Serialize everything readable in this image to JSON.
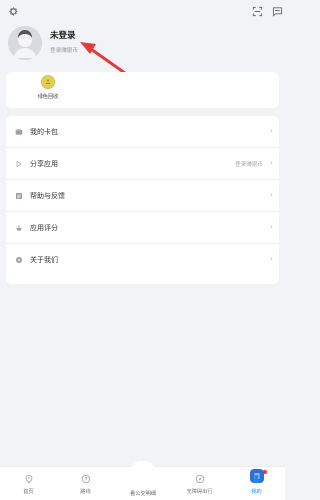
{
  "header": {
    "settings_icon": "gear-icon",
    "scan_icon": "scan-icon",
    "message_icon": "message-icon"
  },
  "profile": {
    "name": "未登录",
    "subtitle": "登录赚银币"
  },
  "quick_actions": [
    {
      "label": "绿色回收",
      "icon": "recycle-icon",
      "colors": {
        "fill": "#f2c94c",
        "ring": "#9bd56a"
      }
    }
  ],
  "menu": {
    "items": [
      {
        "label": "我的卡包",
        "icon": "wallet-icon",
        "hint": ""
      },
      {
        "label": "分享应用",
        "icon": "share-icon",
        "hint": "登录赚银币"
      },
      {
        "label": "帮助与反馈",
        "icon": "help-icon",
        "hint": ""
      },
      {
        "label": "应用评分",
        "icon": "rating-icon",
        "hint": ""
      },
      {
        "label": "关于我们",
        "icon": "about-icon",
        "hint": ""
      }
    ]
  },
  "tabbar": {
    "tabs": [
      {
        "label": "首页",
        "icon": "home-icon"
      },
      {
        "label": "路线",
        "icon": "route-icon"
      },
      {
        "label": "看公交明细",
        "icon": "bus-detail-icon"
      },
      {
        "label": "无障碍出行",
        "icon": "accessibility-icon"
      },
      {
        "label": "我的",
        "icon": "user-icon"
      }
    ],
    "active_index": 4,
    "accent": "#1a8fe3"
  }
}
